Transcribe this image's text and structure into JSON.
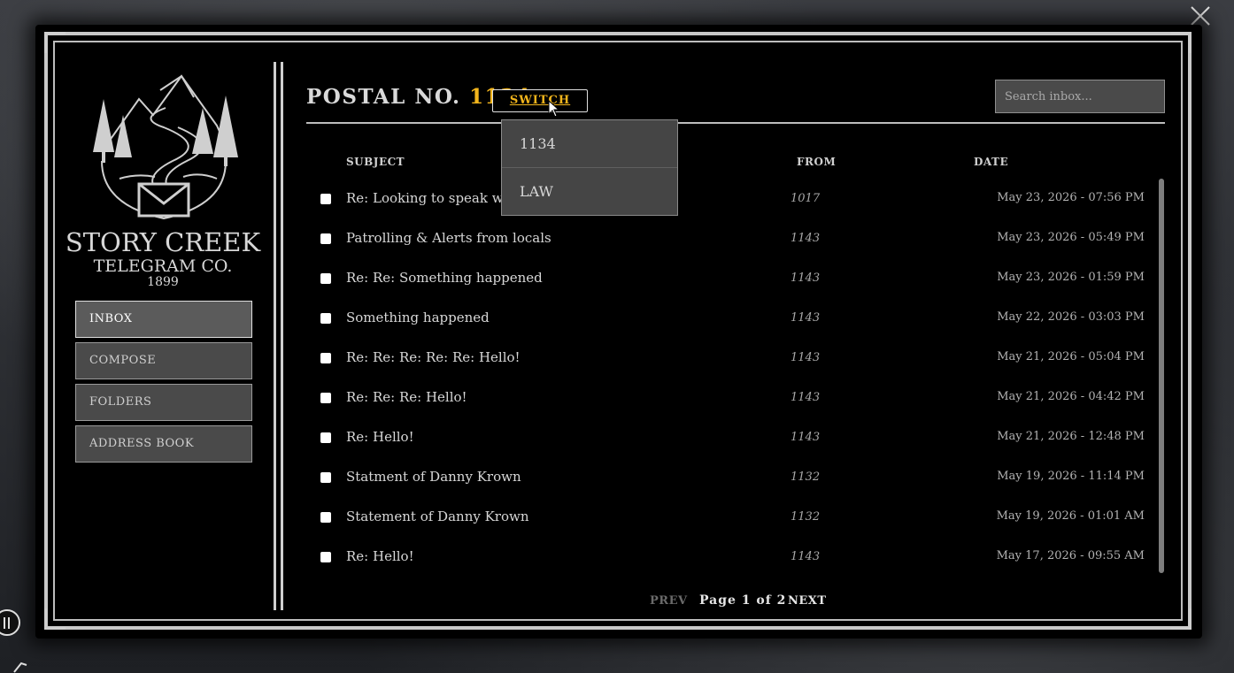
{
  "brand": {
    "name": "STORY CREEK",
    "subtitle": "TELEGRAM CO.",
    "year": "1899"
  },
  "nav": {
    "items": [
      {
        "label": "INBOX",
        "active": true
      },
      {
        "label": "COMPOSE",
        "active": false
      },
      {
        "label": "FOLDERS",
        "active": false
      },
      {
        "label": "ADDRESS BOOK",
        "active": false
      }
    ]
  },
  "header": {
    "title_prefix": "POSTAL NO.",
    "postal_number": "1134",
    "switch_label": "SWITCH",
    "search_placeholder": "Search inbox..."
  },
  "dropdown": {
    "options": [
      "1134",
      "LAW"
    ]
  },
  "columns": {
    "subject": "SUBJECT",
    "from": "FROM",
    "date": "DATE"
  },
  "messages": [
    {
      "subject": "Re: Looking to speak with y",
      "from": "1017",
      "date": "May 23, 2026 - 07:56 PM"
    },
    {
      "subject": "Patrolling & Alerts from locals",
      "from": "1143",
      "date": "May 23, 2026 - 05:49 PM"
    },
    {
      "subject": "Re: Re: Something happened",
      "from": "1143",
      "date": "May 23, 2026 - 01:59 PM"
    },
    {
      "subject": "Something happened",
      "from": "1143",
      "date": "May 22, 2026 - 03:03 PM"
    },
    {
      "subject": "Re: Re: Re: Re: Re: Hello!",
      "from": "1143",
      "date": "May 21, 2026 - 05:04 PM"
    },
    {
      "subject": "Re: Re: Re: Hello!",
      "from": "1143",
      "date": "May 21, 2026 - 04:42 PM"
    },
    {
      "subject": "Re: Hello!",
      "from": "1143",
      "date": "May 21, 2026 - 12:48 PM"
    },
    {
      "subject": "Statment of Danny Krown",
      "from": "1132",
      "date": "May 19, 2026 - 11:14 PM"
    },
    {
      "subject": "Statement of Danny Krown",
      "from": "1132",
      "date": "May 19, 2026 - 01:01 AM"
    },
    {
      "subject": "Re: Hello!",
      "from": "1143",
      "date": "May 17, 2026 - 09:55 AM"
    }
  ],
  "pager": {
    "prev": "PREV",
    "info": "Page 1 of 2",
    "next": "NEXT"
  },
  "colors": {
    "accent": "#f2b51c",
    "panel": "#000000",
    "button": "#4a4a4a"
  }
}
